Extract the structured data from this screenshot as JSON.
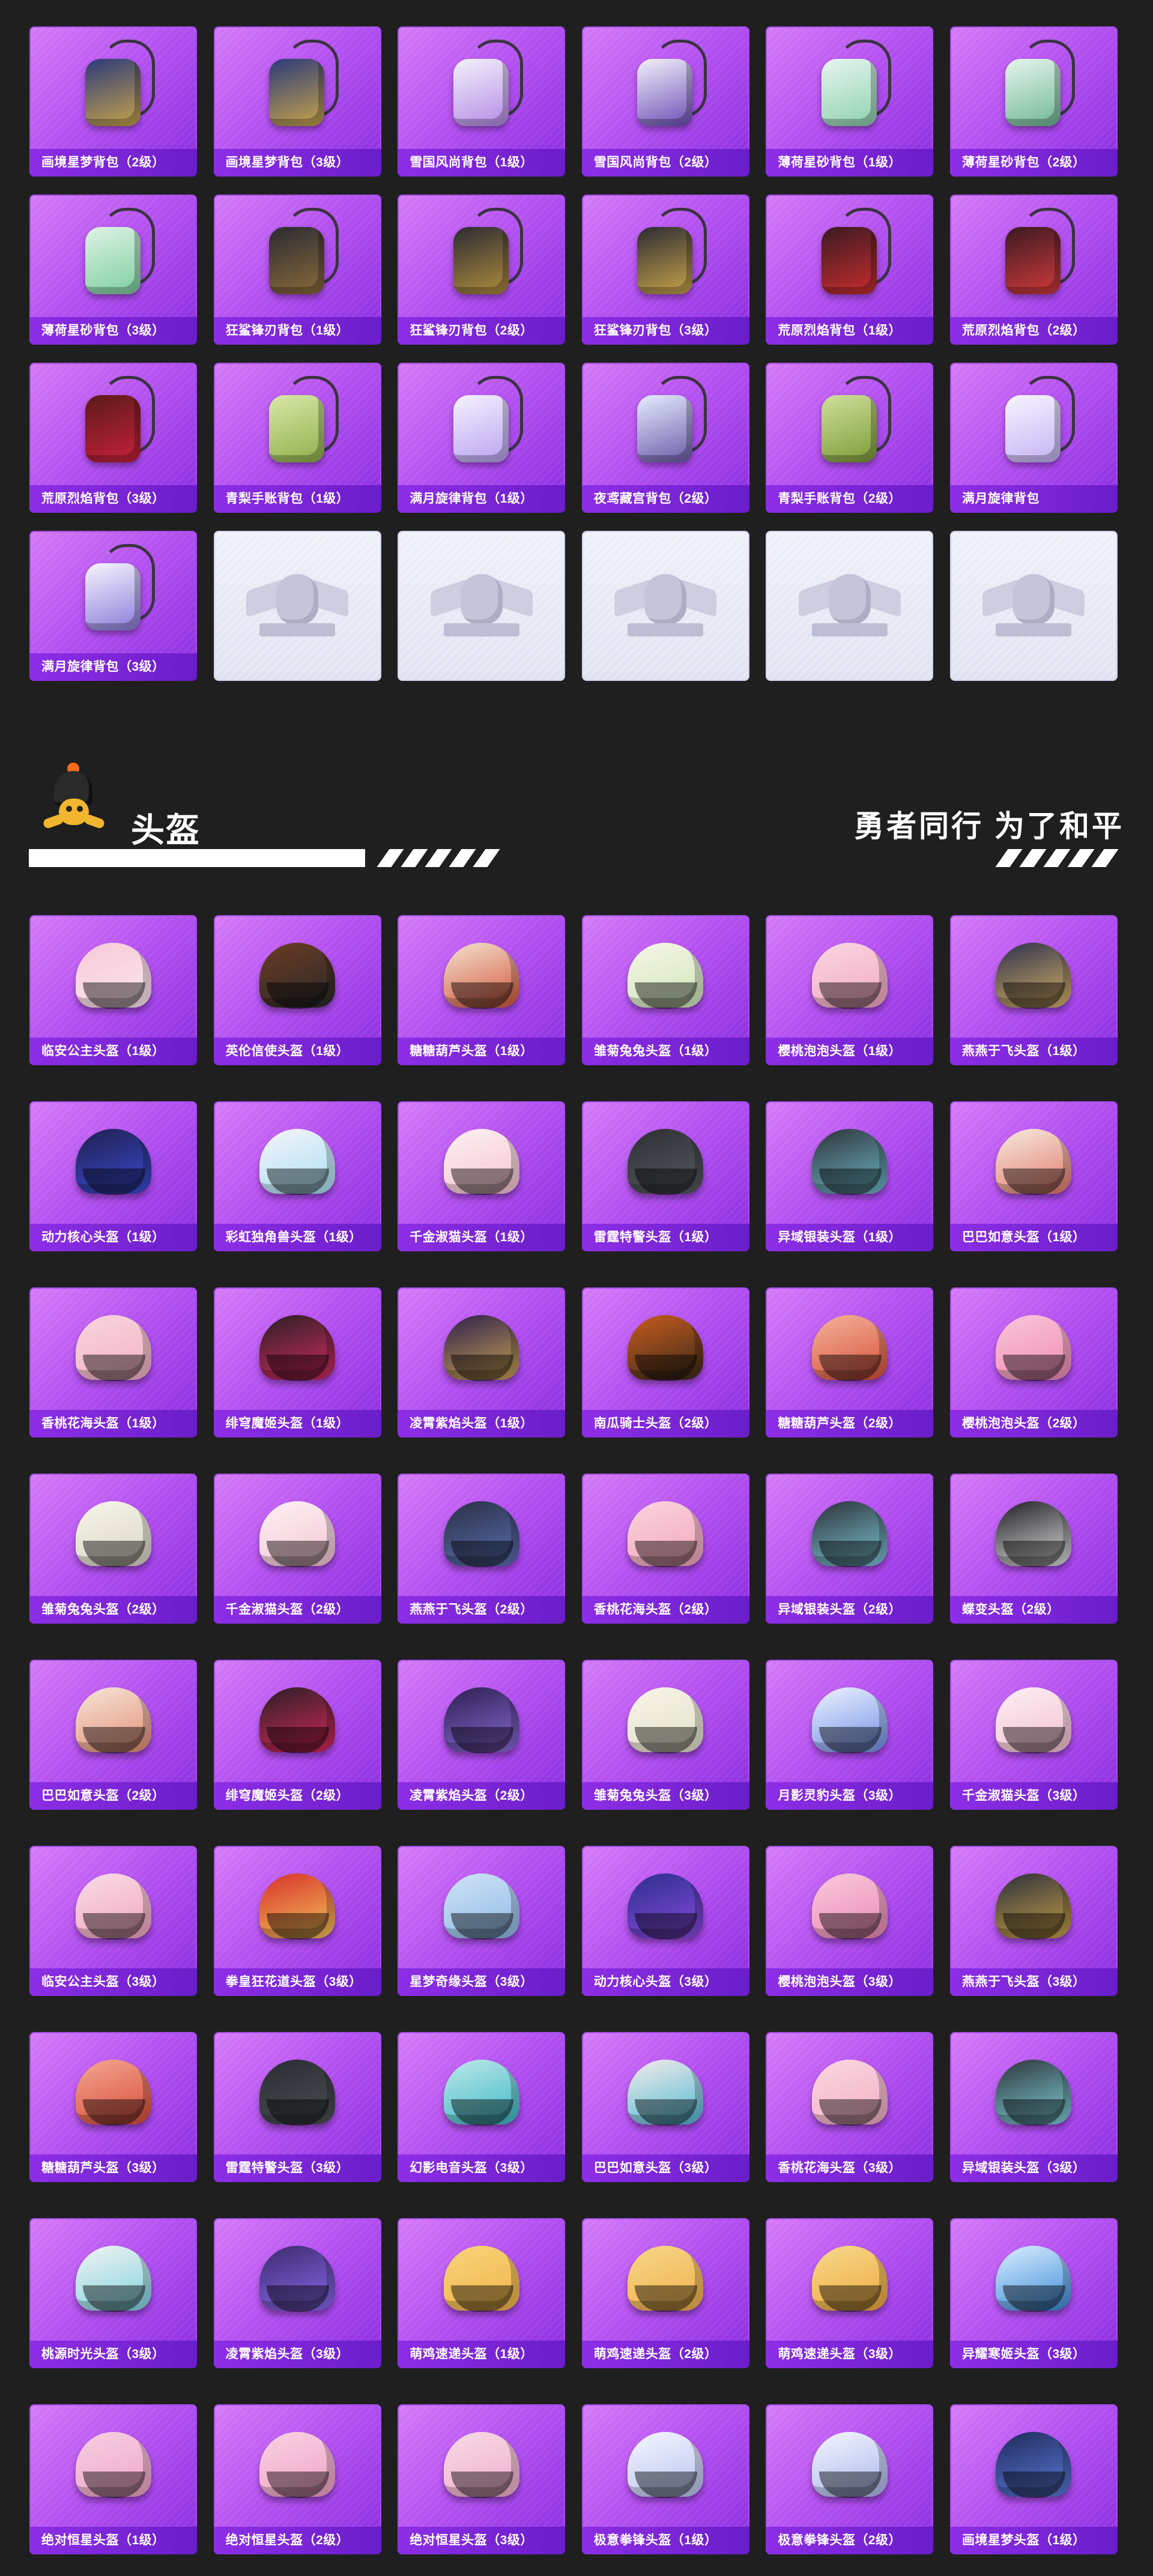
{
  "bags": [
    {
      "label": "画境星梦背包（2级）",
      "colors": [
        "#2a3a7a",
        "#c9a44a"
      ]
    },
    {
      "label": "画境星梦背包（3级）",
      "colors": [
        "#2a3a7a",
        "#c9a44a"
      ]
    },
    {
      "label": "雪国风尚背包（1级）",
      "colors": [
        "#f3f1fb",
        "#b48be6"
      ]
    },
    {
      "label": "雪国风尚背包（2级）",
      "colors": [
        "#f3f1fb",
        "#6a4fb5"
      ]
    },
    {
      "label": "薄荷星砂背包（1级）",
      "colors": [
        "#e7f5ee",
        "#8ed1b0"
      ]
    },
    {
      "label": "薄荷星砂背包（2级）",
      "colors": [
        "#e7f5ee",
        "#6fb894"
      ]
    },
    {
      "label": "薄荷星砂背包（3级）",
      "colors": [
        "#dff2e6",
        "#7ccf9e"
      ]
    },
    {
      "label": "狂鲨锋刃背包（1级）",
      "colors": [
        "#2b2b33",
        "#8a6a3a"
      ]
    },
    {
      "label": "狂鲨锋刃背包（2级）",
      "colors": [
        "#2b2b33",
        "#b08d3c"
      ]
    },
    {
      "label": "狂鲨锋刃背包（3级）",
      "colors": [
        "#2b2b33",
        "#c9a44a"
      ]
    },
    {
      "label": "荒原烈焰背包（1级）",
      "colors": [
        "#3a1a22",
        "#c82d2d"
      ]
    },
    {
      "label": "荒原烈焰背包（2级）",
      "colors": [
        "#3a1a22",
        "#d13a3a"
      ]
    },
    {
      "label": "荒原烈焰背包（3级）",
      "colors": [
        "#5a1a1a",
        "#c8213a"
      ]
    },
    {
      "label": "青梨手账背包（1级）",
      "colors": [
        "#d9e7a8",
        "#8fb04a"
      ]
    },
    {
      "label": "满月旋律背包（1级）",
      "colors": [
        "#f4f2ff",
        "#b9a3f0"
      ]
    },
    {
      "label": "夜鸢藏宫背包（2级）",
      "colors": [
        "#e6ecff",
        "#6a5aa8"
      ]
    },
    {
      "label": "青梨手账背包（2级）",
      "colors": [
        "#cfe09a",
        "#7c9b38"
      ]
    },
    {
      "label": "满月旋律背包",
      "colors": [
        "#f7f5ff",
        "#c4b2f4"
      ]
    },
    {
      "label": "满月旋律背包（3级）",
      "colors": [
        "#f7f5ff",
        "#8a7ad8"
      ]
    },
    {
      "label": "",
      "empty": true
    },
    {
      "label": "",
      "empty": true
    },
    {
      "label": "",
      "empty": true
    },
    {
      "label": "",
      "empty": true
    },
    {
      "label": "",
      "empty": true
    }
  ],
  "section": {
    "title": "头盔",
    "slogan": "勇者同行 为了和平"
  },
  "helmets": [
    {
      "label": "临安公主头盔（1级）",
      "colors": [
        "#f7c9d8",
        "#fbe6ee"
      ]
    },
    {
      "label": "英伦信使头盔（1级）",
      "colors": [
        "#6b3a22",
        "#2a2a2a"
      ]
    },
    {
      "label": "糖糖葫芦头盔（1级）",
      "colors": [
        "#f4e3d0",
        "#d2553a"
      ]
    },
    {
      "label": "雏菊兔兔头盔（1级）",
      "colors": [
        "#f7f5e8",
        "#cfe7b8"
      ]
    },
    {
      "label": "樱桃泡泡头盔（1级）",
      "colors": [
        "#f9d6e2",
        "#f3a9c2"
      ]
    },
    {
      "label": "燕燕于飞头盔（1级）",
      "colors": [
        "#2a2f4a",
        "#d9b36a"
      ]
    },
    {
      "label": "动力核心头盔（1级）",
      "colors": [
        "#1f1f4d",
        "#3a4bd1"
      ]
    },
    {
      "label": "彩虹独角兽头盔（1级）",
      "colors": [
        "#f7f3fb",
        "#a7e0f2"
      ]
    },
    {
      "label": "千金淑猫头盔（1级）",
      "colors": [
        "#fdf1f3",
        "#f5c4cf"
      ]
    },
    {
      "label": "雷霆特警头盔（1级）",
      "colors": [
        "#2d2f33",
        "#55595f"
      ]
    },
    {
      "label": "异域银装头盔（1级）",
      "colors": [
        "#2d3238",
        "#6fb8c9"
      ]
    },
    {
      "label": "巴巴如意头盔（1级）",
      "colors": [
        "#f7ebe0",
        "#e07a6a"
      ]
    },
    {
      "label": "香桃花海头盔（1级）",
      "colors": [
        "#f8d4dc",
        "#f2b3c3"
      ]
    },
    {
      "label": "绯穹魔姬头盔（1级）",
      "colors": [
        "#2a1f24",
        "#d12a62"
      ]
    },
    {
      "label": "凌霄紫焰头盔（1级）",
      "colors": [
        "#2b1f4a",
        "#caa256"
      ]
    },
    {
      "label": "南瓜骑士头盔（2级）",
      "colors": [
        "#c85b1e",
        "#3a2a1a"
      ]
    },
    {
      "label": "糖糖葫芦头盔（2级）",
      "colors": [
        "#f3b39a",
        "#d9503a"
      ]
    },
    {
      "label": "樱桃泡泡头盔（2级）",
      "colors": [
        "#f9c6da",
        "#f08cb2"
      ]
    },
    {
      "label": "雏菊兔兔头盔（2级）",
      "colors": [
        "#f7f5ea",
        "#d9d6c4"
      ]
    },
    {
      "label": "千金淑猫头盔（2级）",
      "colors": [
        "#fdf1f4",
        "#f4c6d3"
      ]
    },
    {
      "label": "燕燕于飞头盔（2级）",
      "colors": [
        "#2a2f45",
        "#5a6fb0"
      ]
    },
    {
      "label": "香桃花海头盔（2级）",
      "colors": [
        "#f9d3dd",
        "#f4a8bd"
      ]
    },
    {
      "label": "异域银装头盔（2级）",
      "colors": [
        "#2b3036",
        "#7ec7d8"
      ]
    },
    {
      "label": "蝶变头盔（2级）",
      "colors": [
        "#1f1f24",
        "#e0e0e0"
      ]
    },
    {
      "label": "巴巴如意头盔（2级）",
      "colors": [
        "#f6e6d8",
        "#e38e76"
      ]
    },
    {
      "label": "绯穹魔姬头盔（2级）",
      "colors": [
        "#2a1f24",
        "#d4285c"
      ]
    },
    {
      "label": "凌霄紫焰头盔（2级）",
      "colors": [
        "#2a1f4d",
        "#8b6ad9"
      ]
    },
    {
      "label": "雏菊兔兔头盔（3级）",
      "colors": [
        "#f7f4e6",
        "#e3e0cb"
      ]
    },
    {
      "label": "月影灵豹头盔（3级）",
      "colors": [
        "#eef3ff",
        "#6f8fe6"
      ]
    },
    {
      "label": "千金淑猫头盔（3级）",
      "colors": [
        "#fdf0f4",
        "#f3bfd0"
      ]
    },
    {
      "label": "临安公主头盔（3级）",
      "colors": [
        "#f9dbe6",
        "#f2a7c0"
      ]
    },
    {
      "label": "拳皇狂花道头盔（3级）",
      "colors": [
        "#d6302a",
        "#f4c35a"
      ]
    },
    {
      "label": "星梦奇缘头盔（3级）",
      "colors": [
        "#cfe4f6",
        "#8fb9e6"
      ]
    },
    {
      "label": "动力核心头盔（3级）",
      "colors": [
        "#2a2f8a",
        "#8a4ae0"
      ]
    },
    {
      "label": "樱桃泡泡头盔（3级）",
      "colors": [
        "#f9c9dc",
        "#ec8ab4"
      ]
    },
    {
      "label": "燕燕于飞头盔（3级）",
      "colors": [
        "#2a2f3a",
        "#c9a04a"
      ]
    },
    {
      "label": "糖糖葫芦头盔（3级）",
      "colors": [
        "#f2a891",
        "#d94a3a"
      ]
    },
    {
      "label": "雷霆特警头盔（3级）",
      "colors": [
        "#2a2c30",
        "#4a4f55"
      ]
    },
    {
      "label": "幻影电音头盔（3级）",
      "colors": [
        "#bfe9ea",
        "#3ab7c4"
      ]
    },
    {
      "label": "巴巴如意头盔（3级）",
      "colors": [
        "#f6ece8",
        "#4fb8d6"
      ]
    },
    {
      "label": "香桃花海头盔（3级）",
      "colors": [
        "#f9d8e0",
        "#f3aec3"
      ]
    },
    {
      "label": "异域银装头盔（3级）",
      "colors": [
        "#2e3338",
        "#7fd0dc"
      ]
    },
    {
      "label": "桃源时光头盔（3级）",
      "colors": [
        "#f2f2f2",
        "#7fd4e0"
      ]
    },
    {
      "label": "凌霄紫焰头盔（3级）",
      "colors": [
        "#3a2a6a",
        "#8a6af0"
      ]
    },
    {
      "label": "萌鸡速递头盔（1级）",
      "colors": [
        "#f6d37a",
        "#f3b54a"
      ]
    },
    {
      "label": "萌鸡速递头盔（2级）",
      "colors": [
        "#f6d78a",
        "#f2b04a"
      ]
    },
    {
      "label": "萌鸡速递头盔（3级）",
      "colors": [
        "#f7d98c",
        "#efa93e"
      ]
    },
    {
      "label": "异耀寒姬头盔（3级）",
      "colors": [
        "#dcefff",
        "#3a8ad9"
      ]
    },
    {
      "label": "绝对恒星头盔（1级）",
      "colors": [
        "#f6cfe0",
        "#f0a6c8"
      ]
    },
    {
      "label": "绝对恒星头盔（2级）",
      "colors": [
        "#f7d3e3",
        "#f2a2c5"
      ]
    },
    {
      "label": "绝对恒星头盔（3级）",
      "colors": [
        "#f7d9e6",
        "#f0b0cc"
      ]
    },
    {
      "label": "极意拳锋头盔（1级）",
      "colors": [
        "#f4f6ff",
        "#b9c4ee"
      ]
    },
    {
      "label": "极意拳锋头盔（2级）",
      "colors": [
        "#f4f6ff",
        "#a9b6ea"
      ]
    },
    {
      "label": "画境星梦头盔（1级）",
      "colors": [
        "#1f2a5a",
        "#5a7ad9"
      ]
    }
  ]
}
